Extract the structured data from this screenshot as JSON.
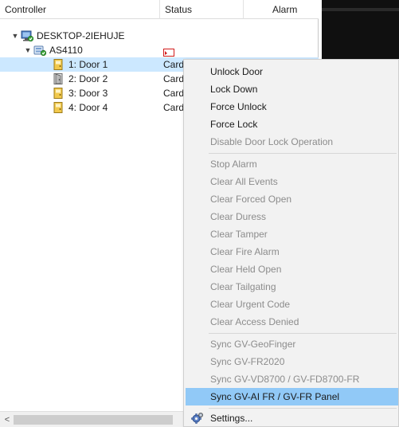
{
  "tree": {
    "columns": {
      "controller": "Controller",
      "status": "Status",
      "alarm": "Alarm"
    },
    "root": {
      "label": "DESKTOP-2IEHUJE",
      "expanded": true
    },
    "controller": {
      "label": "AS4110",
      "expanded": true
    },
    "doors": [
      {
        "label": "1: Door 1",
        "status": "Card Mode",
        "selected": true
      },
      {
        "label": "2: Door 2",
        "status": "Card",
        "selected": false
      },
      {
        "label": "3: Door 3",
        "status": "Card",
        "selected": false
      },
      {
        "label": "4: Door 4",
        "status": "Card",
        "selected": false
      }
    ]
  },
  "context_menu": {
    "groups": [
      [
        {
          "label": "Unlock Door",
          "enabled": true
        },
        {
          "label": "Lock Down",
          "enabled": true
        },
        {
          "label": "Force Unlock",
          "enabled": true
        },
        {
          "label": "Force Lock",
          "enabled": true
        },
        {
          "label": "Disable Door Lock Operation",
          "enabled": false
        }
      ],
      [
        {
          "label": "Stop Alarm",
          "enabled": false
        },
        {
          "label": "Clear All Events",
          "enabled": false
        },
        {
          "label": "Clear Forced Open",
          "enabled": false
        },
        {
          "label": "Clear Duress",
          "enabled": false
        },
        {
          "label": "Clear Tamper",
          "enabled": false
        },
        {
          "label": "Clear Fire Alarm",
          "enabled": false
        },
        {
          "label": "Clear Held Open",
          "enabled": false
        },
        {
          "label": "Clear Tailgating",
          "enabled": false
        },
        {
          "label": "Clear Urgent Code",
          "enabled": false
        },
        {
          "label": "Clear Access Denied",
          "enabled": false
        }
      ],
      [
        {
          "label": "Sync GV-GeoFinger",
          "enabled": false
        },
        {
          "label": "Sync GV-FR2020",
          "enabled": false
        },
        {
          "label": "Sync GV-VD8700 / GV-FD8700-FR",
          "enabled": false
        },
        {
          "label": "Sync GV-AI FR / GV-FR Panel",
          "enabled": true,
          "highlighted": true
        }
      ],
      [
        {
          "label": "Settings...",
          "enabled": true,
          "icon": "gear-icon"
        }
      ]
    ]
  },
  "scrollbar": {
    "left_arrow": "<"
  },
  "colors": {
    "selection": "#cce8ff",
    "menu_highlight": "#91c9f7",
    "menu_bg": "#f2f2f2",
    "disabled_text": "#8c8c8c"
  }
}
